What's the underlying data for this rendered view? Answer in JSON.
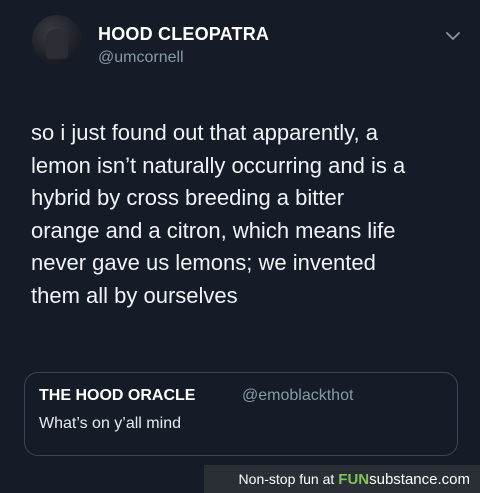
{
  "tweet": {
    "author_name": "HOOD CLEOPATRA",
    "author_handle": "@umcornell",
    "text": "so i just found out that apparently, a\nlemon isn’t naturally occurring and is a\nhybrid by cross breeding a bitter\norange and a citron, which means life\nnever gave us lemons; we invented\nthem all by ourselves"
  },
  "quoted_tweet": {
    "author_name": "THE HOOD ORACLE",
    "author_handle": "@emoblackthot",
    "text": "What’s on y’all mind"
  },
  "watermark": {
    "lead": "Non-stop fun at",
    "brand_bold": "FUN",
    "brand_rest": "substance.com"
  },
  "icons": {
    "menu": "chevron-down-icon"
  },
  "colors": {
    "background": "#151c28",
    "secondary_text": "#8899a6",
    "brand_green": "#7fc35a"
  }
}
